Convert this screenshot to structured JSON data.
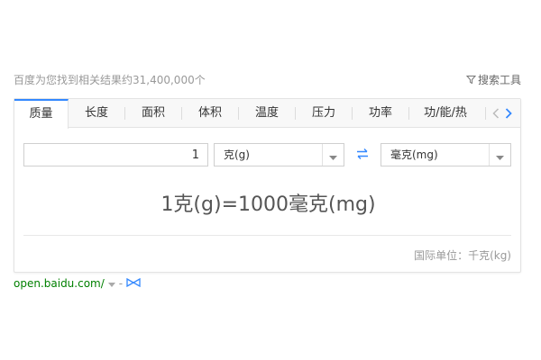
{
  "result_count": "百度为您找到相关结果约31,400,000个",
  "search_tools_label": "搜索工具",
  "tabs": [
    {
      "label": "质量",
      "active": true
    },
    {
      "label": "长度"
    },
    {
      "label": "面积"
    },
    {
      "label": "体积"
    },
    {
      "label": "温度"
    },
    {
      "label": "压力"
    },
    {
      "label": "功率"
    },
    {
      "label": "功/能/热"
    }
  ],
  "converter": {
    "input_value": "1",
    "from_unit": "克(g)",
    "to_unit": "毫克(mg)",
    "result": "1克(g)=1000毫克(mg)",
    "standard_unit": "国际单位：千克(kg)"
  },
  "source": {
    "url": "open.baidu.com/",
    "dash": "-"
  },
  "colors": {
    "accent": "#3388ff",
    "link_green": "#008000",
    "muted": "#999999"
  }
}
